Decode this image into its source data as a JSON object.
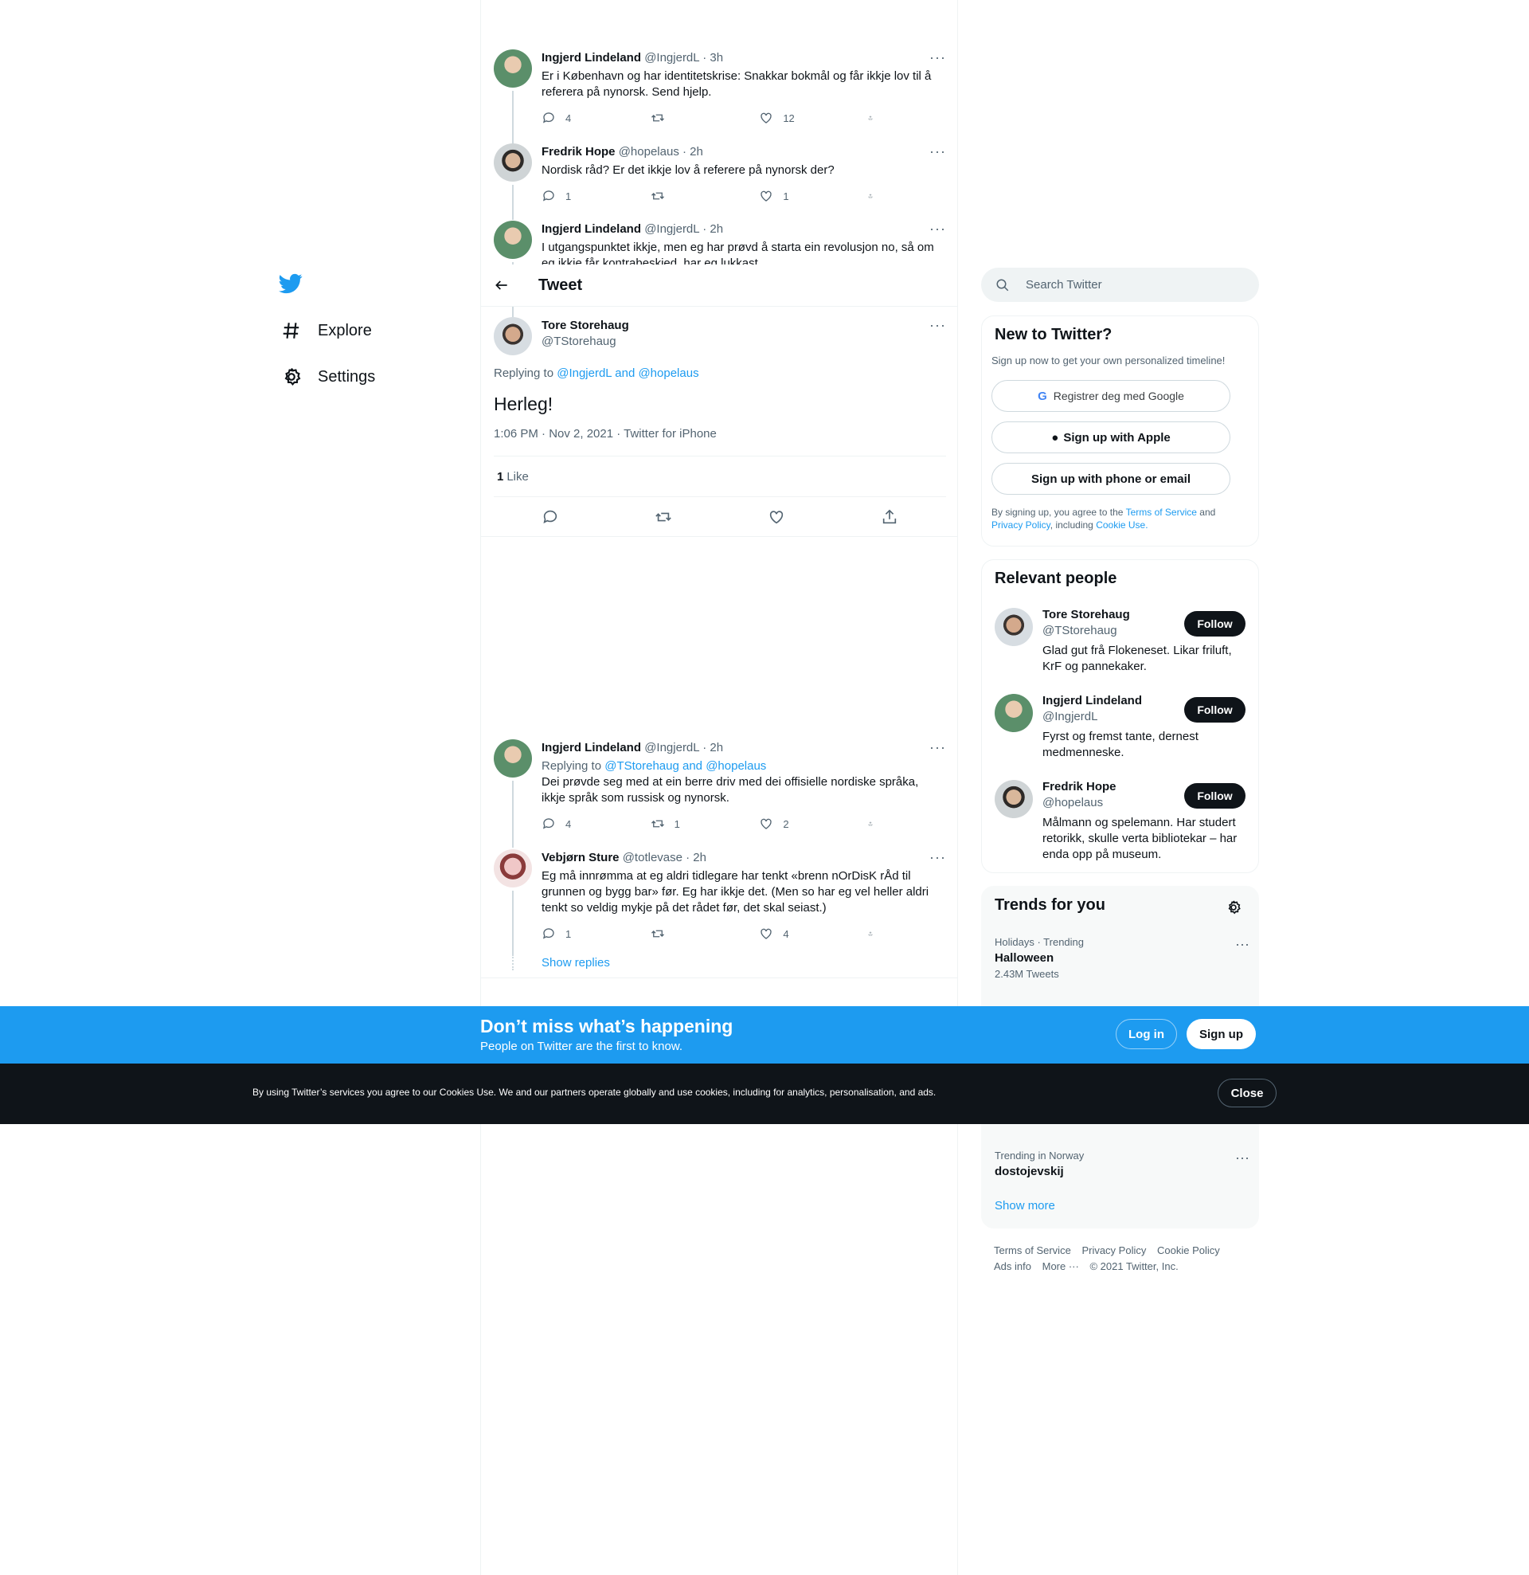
{
  "nav": {
    "explore": "Explore",
    "settings": "Settings"
  },
  "colors": {
    "accent": "#1d9bf0",
    "text": "#0f1419",
    "muted": "#536471",
    "border": "#eff3f4"
  },
  "thread": [
    {
      "name": "Ingjerd Lindeland",
      "handle": "@IngjerdL",
      "time": "· 3h",
      "text": "Er i København og har identitetskrise: Snakkar bokmål og får ikkje lov til å referera på nynorsk. Send hjelp.",
      "replies": "4",
      "retweets": "",
      "likes": "12"
    },
    {
      "name": "Fredrik Hope",
      "handle": "@hopelaus",
      "time": "· 2h",
      "text": "Nordisk råd? Er det ikkje lov å referere på nynorsk der?",
      "replies": "1",
      "retweets": "",
      "likes": "1"
    },
    {
      "name": "Ingjerd Lindeland",
      "handle": "@IngjerdL",
      "time": "· 2h",
      "text": "I utgangspunktet ikkje, men eg har prøvd å starta ein revolusjon no, så om eg ikkje får kontrabeskjed, har eg lukkast."
    }
  ],
  "header": {
    "title": "Tweet"
  },
  "focal": {
    "name": "Tore Storehaug",
    "handle": "@TStorehaug",
    "replying_prefix": "Replying to",
    "replying_to": "@IngjerdL and @hopelaus",
    "text": "Herleg!",
    "meta": "1:06 PM · Nov 2, 2021 · Twitter for iPhone",
    "likes_count": "1",
    "likes_label": "Like"
  },
  "replies": [
    {
      "name": "Ingjerd Lindeland",
      "handle": "@IngjerdL",
      "time": "· 2h",
      "replying_prefix": "Replying to",
      "replying_to": "@TStorehaug and @hopelaus",
      "text": "Dei prøvde seg med at ein berre driv med dei offisielle nordiske språka, ikkje språk som russisk og nynorsk.",
      "replies": "4",
      "retweets": "1",
      "likes": "2"
    },
    {
      "name": "Vebjørn Sture",
      "handle": "@totlevase",
      "time": "· 2h",
      "text": "Eg må innrømma at eg aldri tidlegare har tenkt  «brenn nOrDisK rÅd til grunnen og bygg bar» før. Eg har ikkje det. (Men so har eg vel heller aldri tenkt so veldig mykje på det rådet før, det skal seiast.)",
      "replies": "1",
      "retweets": "",
      "likes": "4"
    }
  ],
  "show_replies": "Show replies",
  "search": {
    "placeholder": "Search Twitter"
  },
  "new_to_twitter": {
    "title": "New to Twitter?",
    "subtitle": "Sign up now to get your own personalized timeline!",
    "google": "Registrer deg med Google",
    "apple": "Sign up with Apple",
    "phone": "Sign up with phone or email",
    "legal_1": "By signing up, you agree to the",
    "terms": "Terms of Service",
    "legal_and": "and",
    "privacy": "Privacy Policy",
    "legal_including": ", including",
    "cookie": "Cookie Use."
  },
  "relevant": {
    "title": "Relevant people",
    "follow_label": "Follow",
    "people": [
      {
        "name": "Tore Storehaug",
        "handle": "@TStorehaug",
        "bio": "Glad gut frå Flokeneset. Likar friluft, KrF og pannekaker."
      },
      {
        "name": "Ingjerd Lindeland",
        "handle": "@IngjerdL",
        "bio": "Fyrst og fremst tante, dernest medmenneske."
      },
      {
        "name": "Fredrik Hope",
        "handle": "@hopelaus",
        "bio": "Målmann og spelemann. Har studert retorikk, skulle verta bibliotekar – har enda opp på museum."
      }
    ]
  },
  "trends": {
    "title": "Trends for you",
    "items": [
      {
        "context": "Holidays · Trending",
        "topic": "Halloween",
        "count": "2.43M Tweets"
      },
      {
        "context": "Trending in Norway",
        "topic": "dostojevskij",
        "count": ""
      }
    ],
    "show_more": "Show more"
  },
  "footer": {
    "terms": "Terms of Service",
    "privacy": "Privacy Policy",
    "cookie": "Cookie Policy",
    "ads": "Ads info",
    "more": "More ···",
    "copyright": "© 2021 Twitter, Inc."
  },
  "signup_bar": {
    "headline": "Don’t miss what’s happening",
    "sub": "People on Twitter are the first to know.",
    "login": "Log in",
    "signup": "Sign up"
  },
  "cookie_bar": {
    "text": "By using Twitter’s services you agree to our Cookies Use. We and our partners operate globally and use cookies, including for analytics, personalisation, and ads.",
    "close": "Close"
  }
}
